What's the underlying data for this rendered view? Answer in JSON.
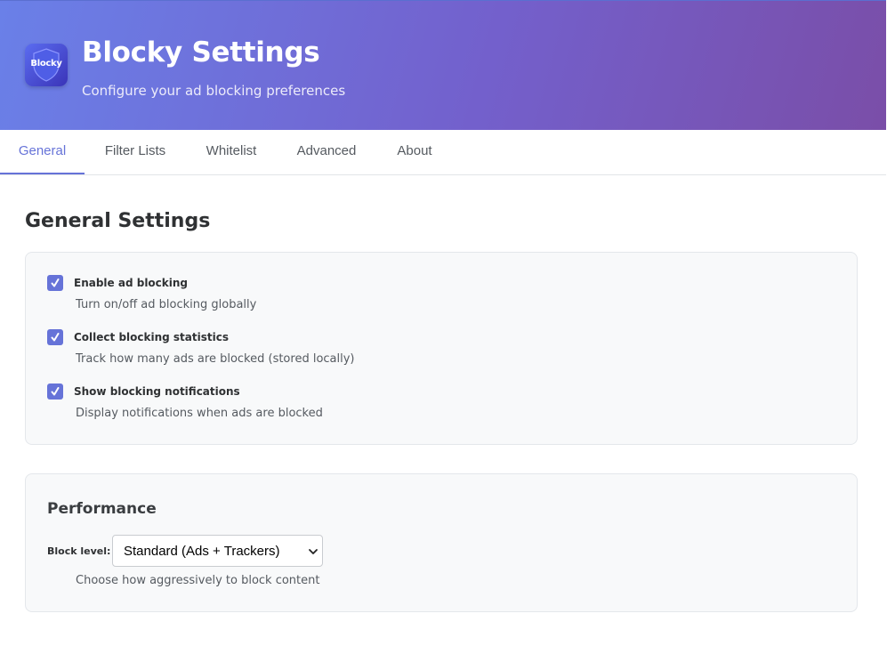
{
  "header": {
    "logo_text": "Blocky",
    "title": "Blocky Settings",
    "subtitle": "Configure your ad blocking preferences"
  },
  "tabs": [
    {
      "label": "General",
      "active": true
    },
    {
      "label": "Filter Lists",
      "active": false
    },
    {
      "label": "Whitelist",
      "active": false
    },
    {
      "label": "Advanced",
      "active": false
    },
    {
      "label": "About",
      "active": false
    }
  ],
  "general": {
    "title": "General Settings",
    "options": [
      {
        "label": "Enable ad blocking",
        "description": "Turn on/off ad blocking globally",
        "checked": true
      },
      {
        "label": "Collect blocking statistics",
        "description": "Track how many ads are blocked (stored locally)",
        "checked": true
      },
      {
        "label": "Show blocking notifications",
        "description": "Display notifications when ads are blocked",
        "checked": true
      }
    ]
  },
  "performance": {
    "title": "Performance",
    "block_level_label": "Block level:",
    "block_level_value": "Standard (Ads + Trackers)",
    "block_level_description": "Choose how aggressively to block content"
  },
  "icons": {
    "logo": "shield-icon",
    "checkbox": "checkmark-icon",
    "select": "chevron-down-icon"
  },
  "colors": {
    "accent": "#6673d8",
    "header_gradient_start": "#6a80e8",
    "header_gradient_end": "#7a4ea8",
    "card_background": "#f8f9fa"
  }
}
